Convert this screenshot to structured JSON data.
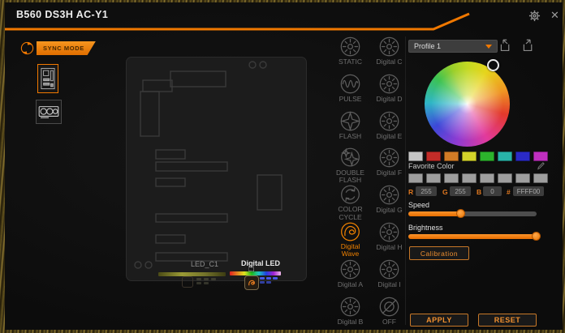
{
  "window": {
    "title": "B560 DS3H AC-Y1",
    "close_glyph": "✕"
  },
  "sidebar": {
    "sync_mode_label": "SYNC MODE",
    "devices": [
      {
        "id": "motherboard",
        "selected": true
      },
      {
        "id": "graphics-card",
        "selected": false
      }
    ]
  },
  "board": {
    "led_c1_label": "LED_C1",
    "digital_led_label": "Digital LED"
  },
  "effects": {
    "items": [
      {
        "label": "STATIC",
        "icon": "sun",
        "selected": false
      },
      {
        "label": "Digital C",
        "icon": "sun",
        "selected": false
      },
      {
        "label": "PULSE",
        "icon": "pulse",
        "selected": false
      },
      {
        "label": "Digital D",
        "icon": "sun",
        "selected": false
      },
      {
        "label": "FLASH",
        "icon": "flash",
        "selected": false
      },
      {
        "label": "Digital E",
        "icon": "sun",
        "selected": false
      },
      {
        "label": "DOUBLE FLASH",
        "icon": "double-flash",
        "selected": false
      },
      {
        "label": "Digital F",
        "icon": "sun",
        "selected": false
      },
      {
        "label": "COLOR CYCLE",
        "icon": "color-cycle",
        "selected": false
      },
      {
        "label": "Digital G",
        "icon": "sun",
        "selected": false
      },
      {
        "label": "Digital Wave",
        "icon": "digital-wave",
        "selected": true
      },
      {
        "label": "Digital H",
        "icon": "sun",
        "selected": false
      },
      {
        "label": "Digital A",
        "icon": "sun",
        "selected": false
      },
      {
        "label": "Digital I",
        "icon": "sun",
        "selected": false
      },
      {
        "label": "Digital B",
        "icon": "sun",
        "selected": false
      },
      {
        "label": "OFF",
        "icon": "off",
        "selected": false
      }
    ]
  },
  "panel": {
    "profile_value": "Profile 1",
    "palette": [
      "#c6c6c6",
      "#c22c28",
      "#d07b26",
      "#d3d32a",
      "#2cb32c",
      "#28b3a8",
      "#2a2ac6",
      "#bf2fbf"
    ],
    "favorite_label": "Favorite Color",
    "favorites": [
      "#9e9e9e",
      "#9e9e9e",
      "#9e9e9e",
      "#9e9e9e",
      "#9e9e9e",
      "#9e9e9e",
      "#9e9e9e",
      "#9e9e9e"
    ],
    "rgb": {
      "r_label": "R",
      "r_value": "255",
      "g_label": "G",
      "g_value": "255",
      "b_label": "B",
      "b_value": "0",
      "hex_label": "#",
      "hex_value": "FFFF00"
    },
    "speed_label": "Speed",
    "speed_percent": 41,
    "brightness_label": "Brightness",
    "brightness_percent": 100,
    "calibration_label": "Calibration",
    "apply_label": "APPLY",
    "reset_label": "RESET"
  },
  "colors": {
    "accent": "#f07800"
  }
}
